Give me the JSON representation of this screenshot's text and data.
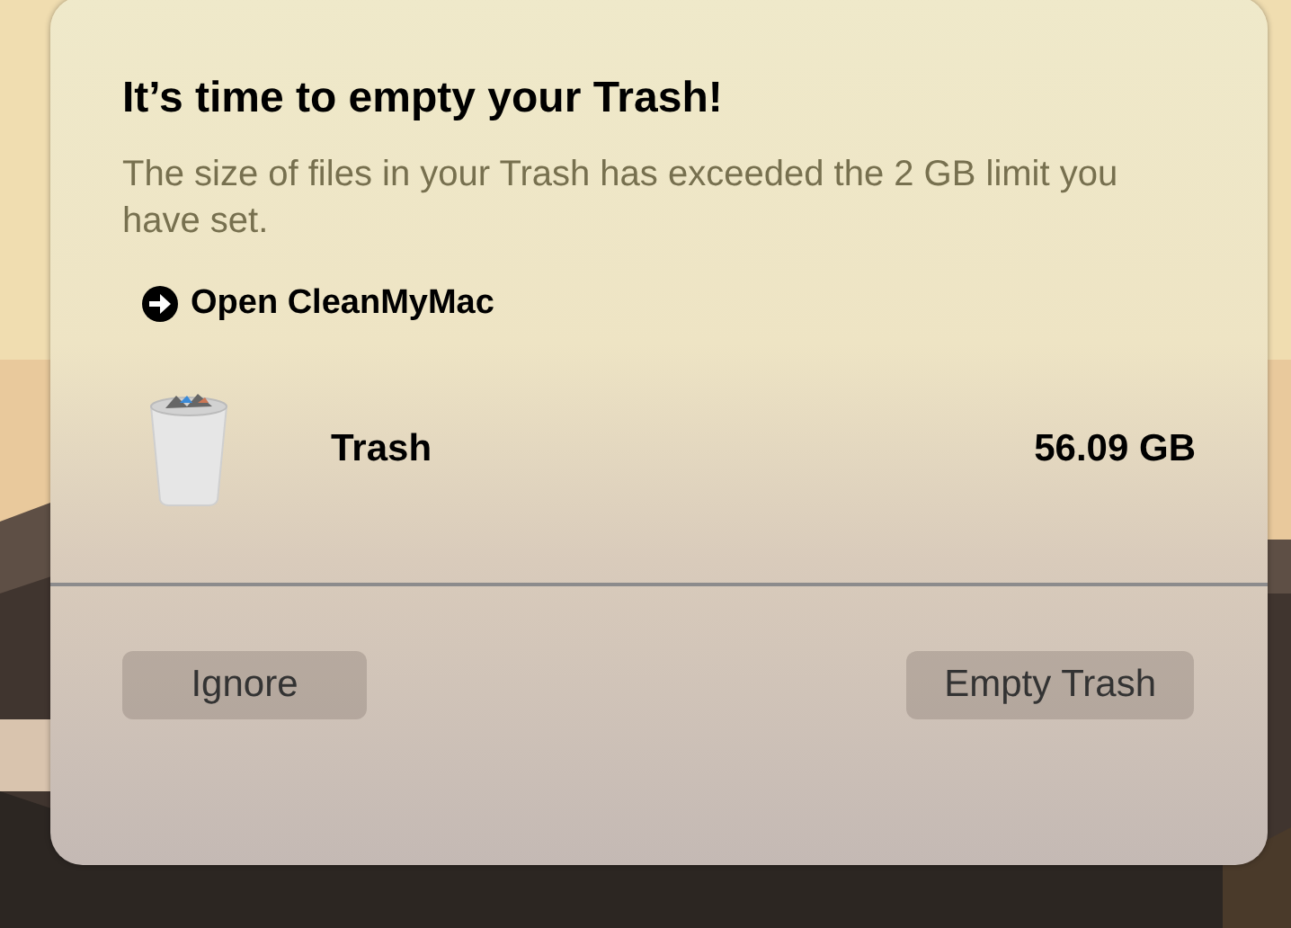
{
  "dialog": {
    "title": "It’s time to empty your Trash!",
    "message": "The size of files in your Trash has exceeded the 2 GB limit you have set.",
    "link": {
      "label": "Open CleanMyMac"
    },
    "items": [
      {
        "name": "Trash",
        "size": "56.09 GB"
      }
    ],
    "buttons": [
      {
        "label": "Ignore"
      },
      {
        "label": "Empty Trash"
      }
    ]
  }
}
